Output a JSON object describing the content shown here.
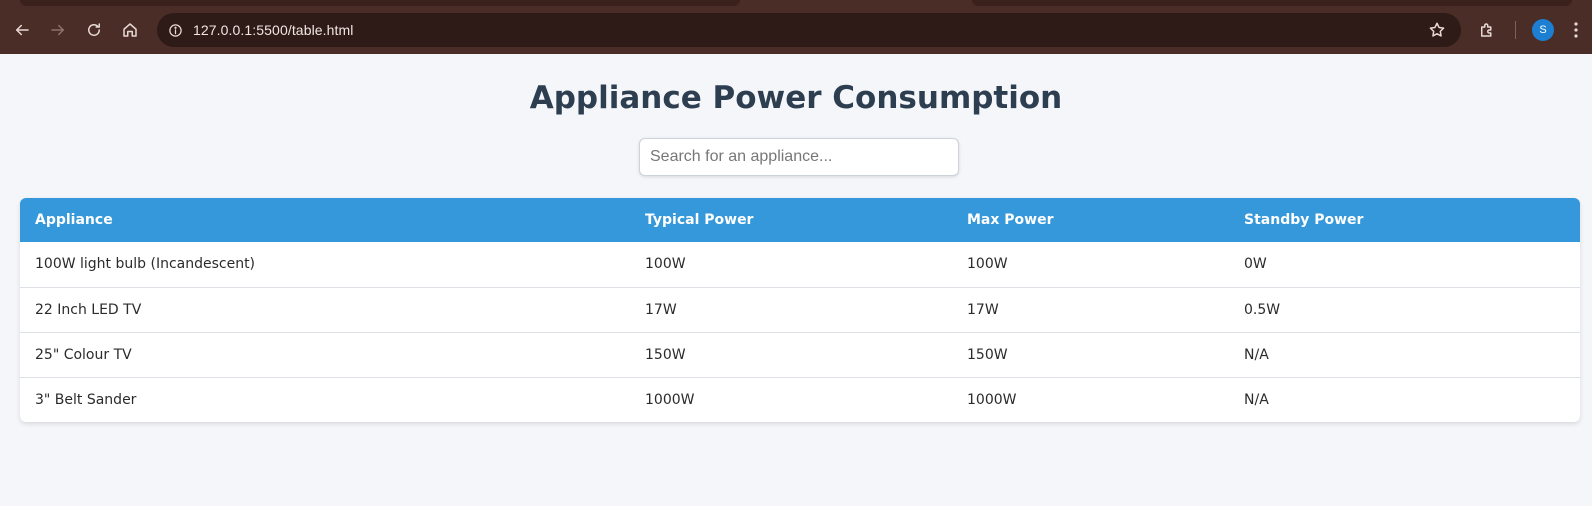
{
  "browser": {
    "url_host": "127.0.0.1",
    "url_rest": ":5500/table.html",
    "profile_initial": "S",
    "icons": [
      "back-icon",
      "forward-icon",
      "reload-icon",
      "home-icon",
      "site-info-icon",
      "bookmark-star-icon",
      "extensions-icon",
      "kebab-menu-icon"
    ]
  },
  "page": {
    "title": "Appliance Power Consumption",
    "search_placeholder": "Search for an appliance..."
  },
  "table": {
    "headers": [
      "Appliance",
      "Typical Power",
      "Max Power",
      "Standby Power"
    ],
    "rows": [
      [
        "100W light bulb (Incandescent)",
        "100W",
        "100W",
        "0W"
      ],
      [
        "22 Inch LED TV",
        "17W",
        "17W",
        "0.5W"
      ],
      [
        "25\" Colour TV",
        "150W",
        "150W",
        "N/A"
      ],
      [
        "3\" Belt Sander",
        "1000W",
        "1000W",
        "N/A"
      ]
    ]
  },
  "colors": {
    "header_bg": "#3498db",
    "title_color": "#2c3e50",
    "chrome_bg": "#4a2d26",
    "page_bg": "#f4f6f9"
  }
}
